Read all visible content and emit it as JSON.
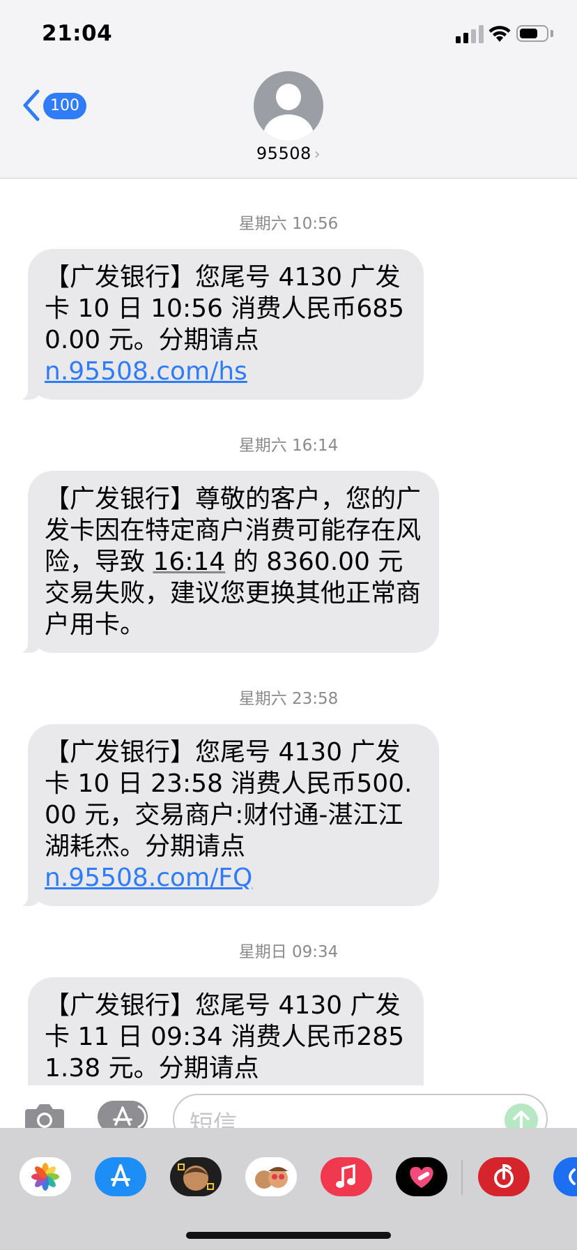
{
  "status_bar": {
    "time": "21:04"
  },
  "header": {
    "back_count": "100",
    "contact": "95508",
    "contact_chevron": "›"
  },
  "thread": [
    {
      "timestamp": "星期六 10:56",
      "text": "【广发银行】您尾号 4130 广发卡 10 日 10:56 消费人民币6850.00 元。分期请点",
      "link": "n.95508.com/hs"
    },
    {
      "timestamp": "星期六 16:14",
      "text_before": "【广发银行】尊敬的客户，您的广发卡因在特定商户消费可能存在风险，导致 ",
      "text_time": "16:14",
      "text_after": " 的 8360.00 元交易失败，建议您更换其他正常商户用卡。"
    },
    {
      "timestamp": "星期六 23:58",
      "text": "【广发银行】您尾号 4130 广发卡 10 日 23:58 消费人民币500.00 元，交易商户:财付通-湛江江湖耗杰。分期请点",
      "link": "n.95508.com/FQ"
    },
    {
      "timestamp": "星期日 09:34",
      "text": "【广发银行】您尾号 4130 广发卡 11 日 09:34 消费人民币2851.38 元。分期请点"
    }
  ],
  "composer": {
    "placeholder": "短信"
  },
  "drawer_apps": [
    "photos-icon",
    "appstore-icon",
    "memoji-icon",
    "animoji-icon",
    "music-icon",
    "heart-icon",
    "netease-music-icon",
    "shazam-icon"
  ],
  "colors": {
    "link": "#2f7cf6",
    "bubble": "#e9e9eb",
    "badge": "#2f7cf6",
    "header_bg": "#f4f4f6"
  }
}
